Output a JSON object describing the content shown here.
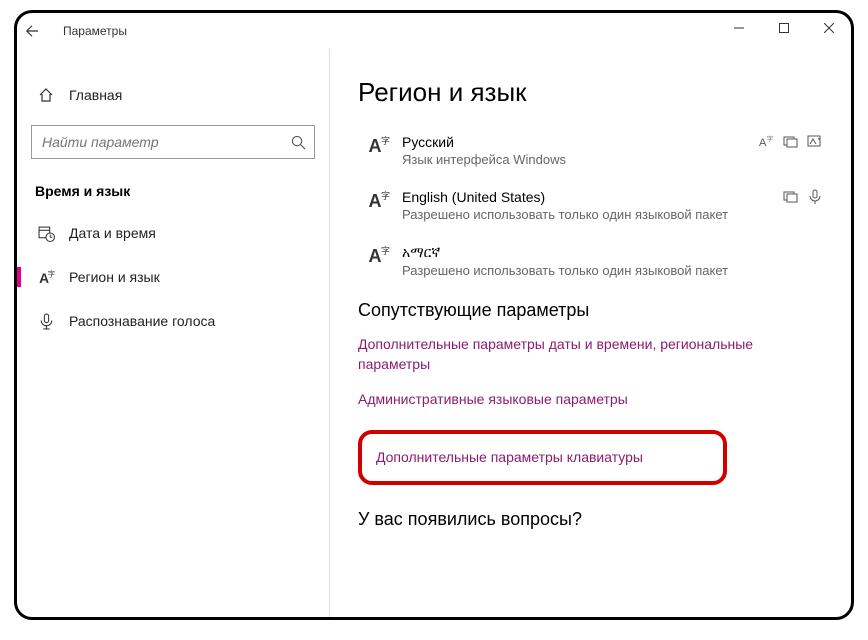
{
  "titlebar": {
    "title": "Параметры"
  },
  "sidebar": {
    "home_label": "Главная",
    "search_placeholder": "Найти параметр",
    "group_title": "Время и язык",
    "items": [
      {
        "label": "Дата и время"
      },
      {
        "label": "Регион и язык"
      },
      {
        "label": "Распознавание голоса"
      }
    ]
  },
  "main": {
    "page_title": "Регион и язык",
    "languages": [
      {
        "name": "Русский",
        "sub": "Язык интерфейса Windows"
      },
      {
        "name": "English (United States)",
        "sub": "Разрешено использовать только один языковой пакет"
      },
      {
        "name": "አማርኛ",
        "sub": "Разрешено использовать только один языковой пакет"
      }
    ],
    "related_title": "Сопутствующие параметры",
    "links": [
      "Дополнительные параметры даты и времени, региональные параметры",
      "Административные языковые параметры",
      "Дополнительные параметры клавиатуры"
    ],
    "questions_title": "У вас появились вопросы?"
  }
}
